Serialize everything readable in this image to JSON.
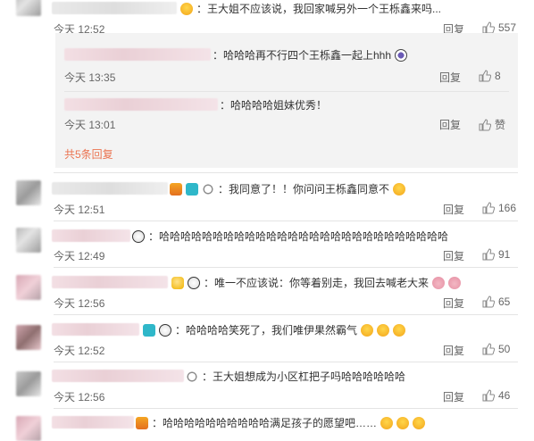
{
  "comments": [
    {
      "text": "：王大姐不应该说，我回家喊另外一个王栎鑫来吗...",
      "time": "今天 12:52",
      "reply_label": "回复",
      "likes": "557"
    },
    {
      "text": "：我同意了！！你问问王栎鑫同意不",
      "time": "今天 12:51",
      "reply_label": "回复",
      "likes": "166"
    },
    {
      "text": "：哈哈哈哈哈哈哈哈哈哈哈哈哈哈哈哈哈哈哈哈哈哈哈哈哈哈哈",
      "time": "今天 12:49",
      "reply_label": "回复",
      "likes": "91"
    },
    {
      "text": "：唯一不应该说：你等着别走，我回去喊老大来",
      "time": "今天 12:56",
      "reply_label": "回复",
      "likes": "65"
    },
    {
      "text": "：哈哈哈哈笑死了，我们唯伊果然霸气",
      "time": "今天 12:52",
      "reply_label": "回复",
      "likes": "50"
    },
    {
      "text": "：王大姐想成为小区杠把子吗哈哈哈哈哈哈",
      "time": "今天 12:56",
      "reply_label": "回复",
      "likes": "46"
    },
    {
      "text": "：哈哈哈哈哈哈哈哈哈哈满足孩子的愿望吧……"
    }
  ],
  "replies": [
    {
      "text": "：哈哈哈再不行四个王栎鑫一起上hhh",
      "time": "今天 13:35",
      "reply_label": "回复",
      "likes": "8"
    },
    {
      "text": "：哈哈哈哈姐妹优秀！",
      "time": "今天 13:01",
      "reply_label": "回复",
      "likes": "赞"
    }
  ],
  "more_replies": "共5条回复",
  "colors": {
    "link": "#eb7350",
    "reply_bg": "#f3f3f3"
  }
}
